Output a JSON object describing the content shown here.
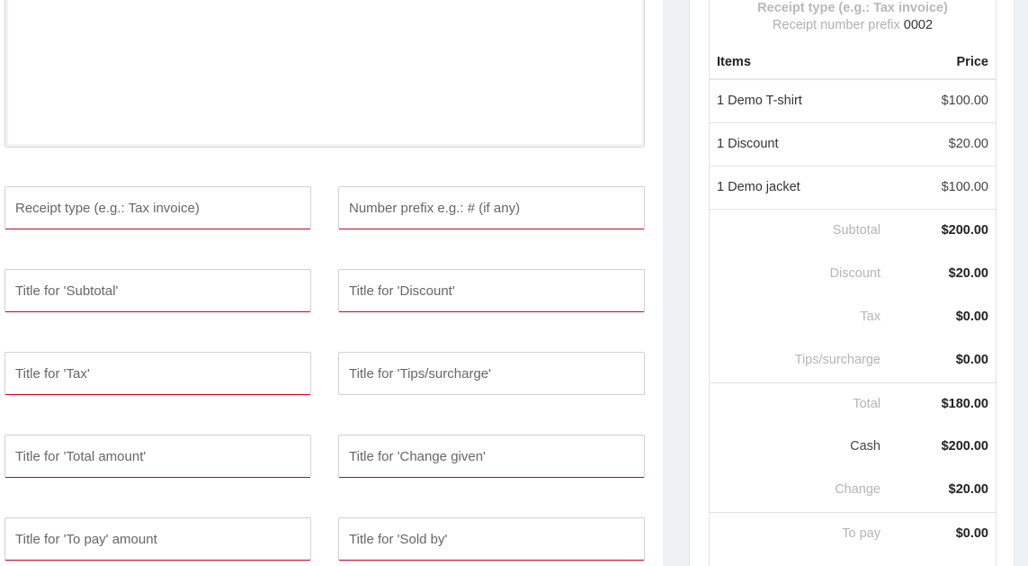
{
  "editor": {
    "textarea": {
      "value": ""
    },
    "fields": [
      {
        "name": "receipt-type-field",
        "placeholder": "Receipt type (e.g.: Tax invoice)"
      },
      {
        "name": "number-prefix-field",
        "placeholder": "Number prefix e.g.: # (if any)"
      },
      {
        "name": "subtotal-title-field",
        "placeholder": "Title for 'Subtotal'"
      },
      {
        "name": "discount-title-field",
        "placeholder": "Title for 'Discount'"
      },
      {
        "name": "tax-title-field",
        "placeholder": "Title for 'Tax'"
      },
      {
        "name": "tips-title-field",
        "placeholder": "Title for 'Tips/surcharge'"
      },
      {
        "name": "total-title-field",
        "placeholder": "Title for 'Total amount'"
      },
      {
        "name": "change-title-field",
        "placeholder": "Title for 'Change given'"
      },
      {
        "name": "to-pay-title-field",
        "placeholder": "Title for 'To pay' amount"
      },
      {
        "name": "sold-by-title-field",
        "placeholder": "Title for 'Sold by'"
      }
    ]
  },
  "receipt": {
    "type_label": "Receipt type (e.g.: Tax invoice)",
    "prefix_label": "Receipt number prefix",
    "prefix_number": "0002",
    "header": {
      "items": "Items",
      "price": "Price"
    },
    "items": [
      {
        "label": "1 Demo T-shirt",
        "price": "$100.00"
      },
      {
        "label": "1 Discount",
        "price": "$20.00"
      },
      {
        "label": "1 Demo jacket",
        "price": "$100.00"
      }
    ],
    "summary": {
      "subtotal": {
        "label": "Subtotal",
        "value": "$200.00"
      },
      "discount": {
        "label": "Discount",
        "value": "$20.00"
      },
      "tax": {
        "label": "Tax",
        "value": "$0.00"
      },
      "tips": {
        "label": "Tips/surcharge",
        "value": "$0.00"
      },
      "total": {
        "label": "Total",
        "value": "$180.00"
      },
      "cash": {
        "label": "Cash",
        "value": "$200.00"
      },
      "change": {
        "label": "Change",
        "value": "$20.00"
      },
      "to_pay": {
        "label": "To pay",
        "value": "$0.00"
      }
    }
  },
  "colors": {
    "accent_underline": "#d0021b",
    "gutter": "#eef1f4"
  }
}
